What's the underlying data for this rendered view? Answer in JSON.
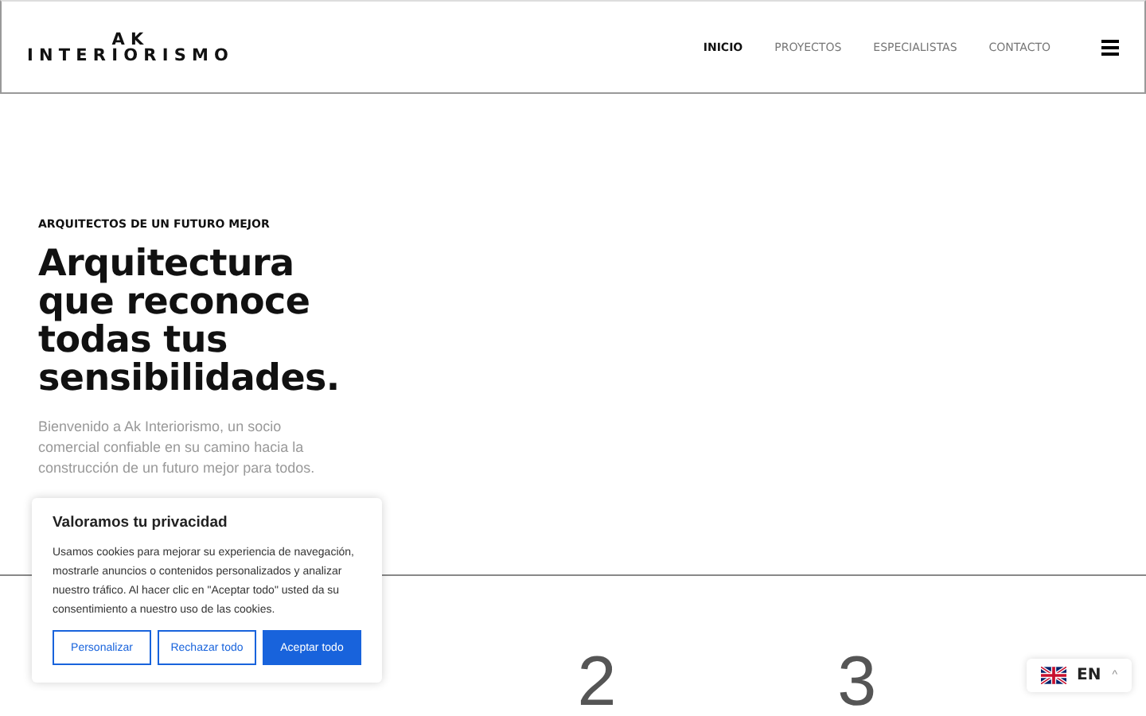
{
  "header": {
    "logo_top": "AK",
    "logo_bottom": "INTERIORISMO",
    "nav": [
      {
        "label": "INICIO",
        "selected": true
      },
      {
        "label": "PROYECTOS",
        "selected": false
      },
      {
        "label": "ESPECIALISTAS",
        "selected": false
      },
      {
        "label": "CONTACTO",
        "selected": false
      }
    ]
  },
  "hero": {
    "eyebrow": "ARQUITECTOS DE UN FUTURO MEJOR",
    "title": "Arquitectura que reconoce todas tus sensibilidades.",
    "text": "Bienvenido a Ak Interiorismo, un socio comercial confiable en su camino hacia la construcción de un futuro mejor para todos."
  },
  "steps": [
    "2",
    "3"
  ],
  "cookie_banner": {
    "title": "Valoramos tu privacidad",
    "text": "Usamos cookies para mejorar su experiencia de navegación, mostrarle anuncios o contenidos personalizados y analizar nuestro tráfico. Al hacer clic en \"Aceptar todo\" usted da su consentimiento a nuestro uso de las cookies.",
    "buttons": [
      {
        "label": "Personalizar",
        "kind": "outline"
      },
      {
        "label": "Rechazar todo",
        "kind": "outline"
      },
      {
        "label": "Aceptar todo",
        "kind": "primary"
      }
    ]
  },
  "language": {
    "code": "EN",
    "caret": "^"
  }
}
